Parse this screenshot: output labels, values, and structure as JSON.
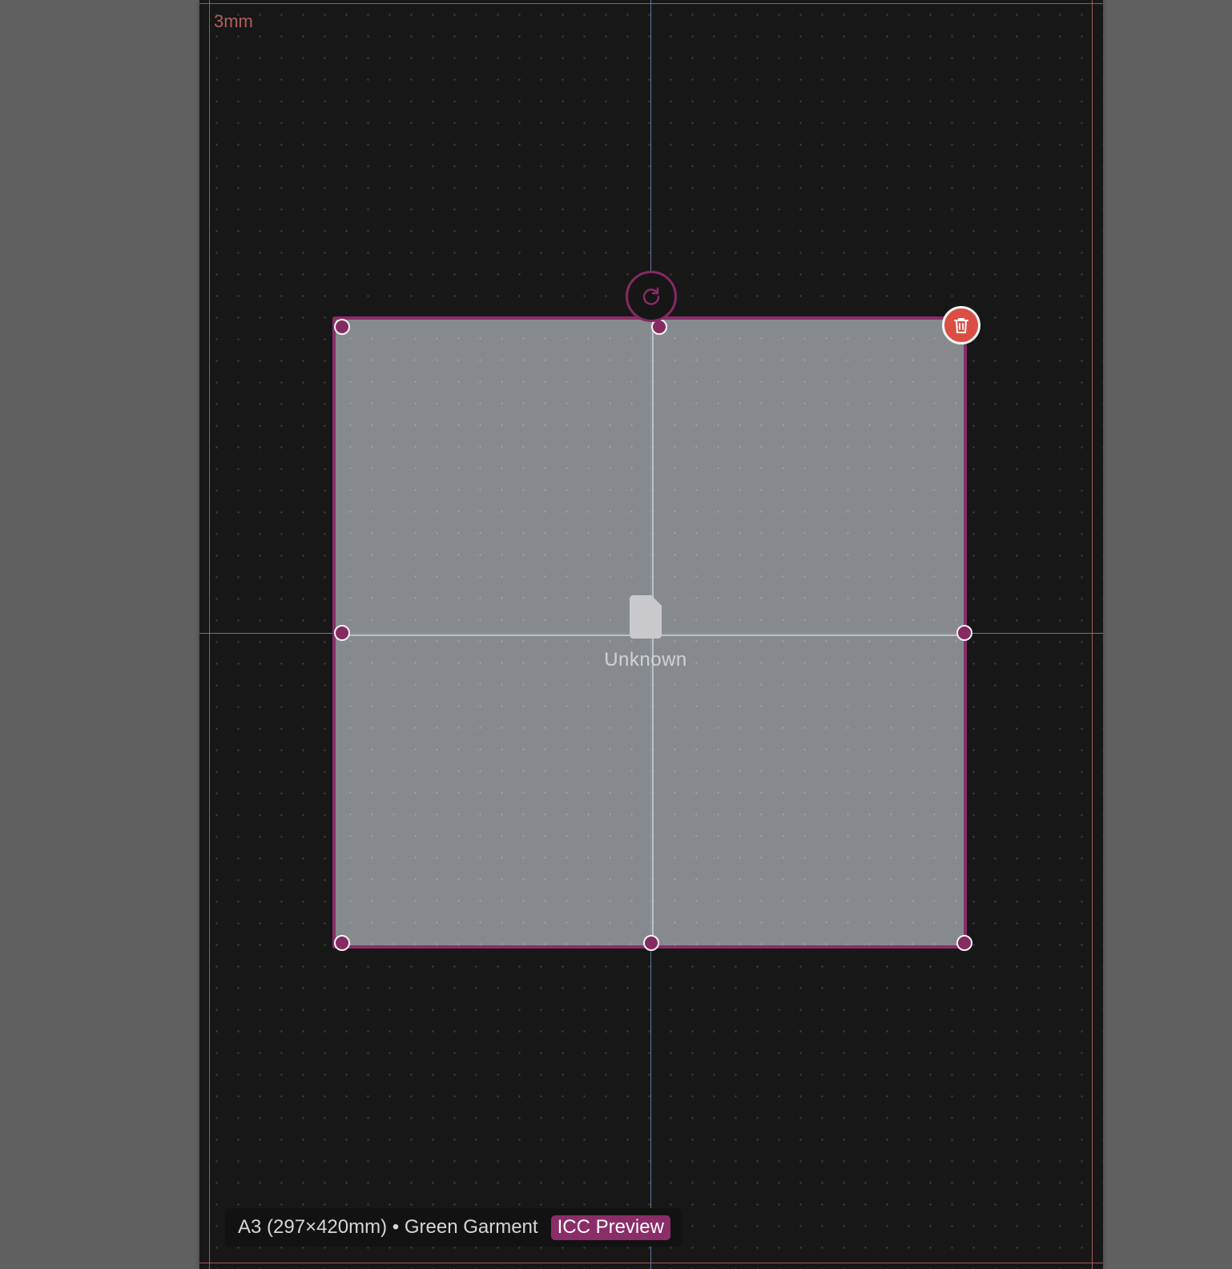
{
  "canvas": {
    "bleed_label": "3mm"
  },
  "object": {
    "file_label": "Unknown",
    "file_icon": "file-icon",
    "rotate_icon": "rotate-icon",
    "delete_icon": "trash-icon"
  },
  "status_bar": {
    "document_info": "A3 (297×420mm) • Green Garment",
    "badge_label": "ICC Preview"
  },
  "colors": {
    "canvas_background": "#171717",
    "workspace_background": "#616161",
    "selection_accent": "#8b2d68",
    "delete_red": "#db4e44",
    "bleed_guide": "#b35e5e",
    "center_guide": "#6f8db0"
  }
}
